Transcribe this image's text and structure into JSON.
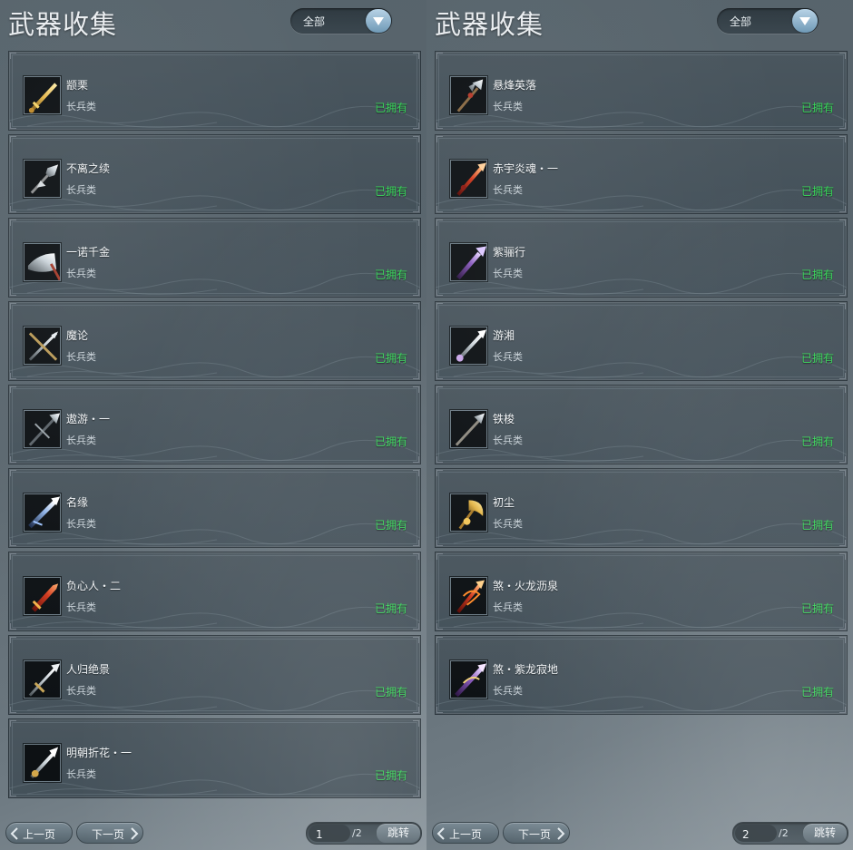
{
  "panels": [
    {
      "title": "武器收集",
      "filter": {
        "label": "全部"
      },
      "items": [
        {
          "name": "颛栗",
          "type": "长兵类",
          "status": "已拥有",
          "icon": "gold-sword-icon"
        },
        {
          "name": "不离之续",
          "type": "长兵类",
          "status": "已拥有",
          "icon": "steel-halberd-icon"
        },
        {
          "name": "一诺千金",
          "type": "长兵类",
          "status": "已拥有",
          "icon": "broad-blade-icon"
        },
        {
          "name": "魔论",
          "type": "长兵类",
          "status": "已拥有",
          "icon": "crossed-spears-icon"
        },
        {
          "name": "遨游・一",
          "type": "长兵类",
          "status": "已拥有",
          "icon": "dark-spear-icon"
        },
        {
          "name": "名缘",
          "type": "长兵类",
          "status": "已拥有",
          "icon": "crystal-spear-icon"
        },
        {
          "name": "负心人・二",
          "type": "长兵类",
          "status": "已拥有",
          "icon": "red-blade-icon"
        },
        {
          "name": "人归绝景",
          "type": "长兵类",
          "status": "已拥有",
          "icon": "silver-spear-icon"
        },
        {
          "name": "明朝折花・一",
          "type": "长兵类",
          "status": "已拥有",
          "icon": "ornate-spear-icon"
        }
      ],
      "footer": {
        "prev_label": "上一页",
        "next_label": "下一页",
        "page": "1",
        "total": "/2",
        "jump_label": "跳转"
      }
    },
    {
      "title": "武器收集",
      "filter": {
        "label": "全部"
      },
      "items": [
        {
          "name": "悬烽英落",
          "type": "长兵类",
          "status": "已拥有",
          "icon": "trident-icon"
        },
        {
          "name": "赤宇炎魂・一",
          "type": "长兵类",
          "status": "已拥有",
          "icon": "crimson-spear-icon"
        },
        {
          "name": "紫骊行",
          "type": "长兵类",
          "status": "已拥有",
          "icon": "purple-spear-icon"
        },
        {
          "name": "游湘",
          "type": "长兵类",
          "status": "已拥有",
          "icon": "flower-spear-icon"
        },
        {
          "name": "铁梭",
          "type": "长兵类",
          "status": "已拥有",
          "icon": "iron-spear-icon"
        },
        {
          "name": "初尘",
          "type": "长兵类",
          "status": "已拥有",
          "icon": "golden-axe-icon"
        },
        {
          "name": "煞・火龙沥泉",
          "type": "长兵类",
          "status": "已拥有",
          "icon": "fire-dragon-spear-icon"
        },
        {
          "name": "煞・紫龙寂地",
          "type": "长兵类",
          "status": "已拥有",
          "icon": "purple-dragon-spear-icon"
        }
      ],
      "footer": {
        "prev_label": "上一页",
        "next_label": "下一页",
        "page": "2",
        "total": "/2",
        "jump_label": "跳转"
      }
    }
  ],
  "colors": {
    "owned": "#39d65a",
    "title": "#e9edf0",
    "panel_bg": "#56636b"
  }
}
